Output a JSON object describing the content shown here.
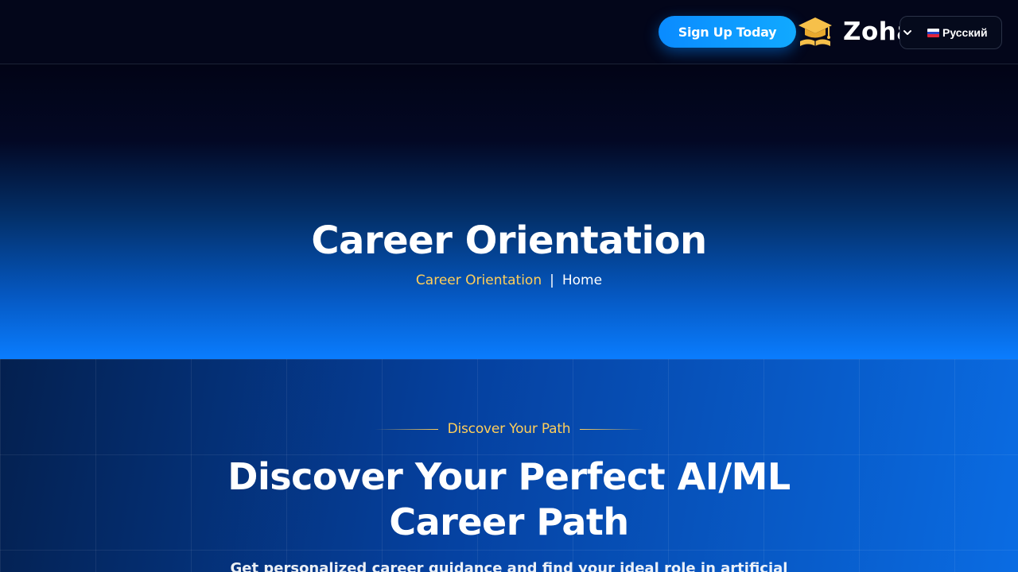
{
  "header": {
    "signup_label": "Sign Up Today",
    "logo_text": "Zoha",
    "language": {
      "selected": "Русский",
      "flag_icon": "russia-flag-icon",
      "chevron_icon": "chevron-down-icon"
    }
  },
  "hero": {
    "title": "Career Orientation",
    "breadcrumb": {
      "current": "Career Orientation",
      "separator": "|",
      "home": "Home"
    }
  },
  "section": {
    "eyebrow": "Discover Your Path",
    "title_line1": "Discover Your Perfect AI/ML",
    "title_line2": "Career Path",
    "subtitle": "Get personalized career guidance and find your ideal role in artificial"
  },
  "colors": {
    "accent_blue": "#0a8bff",
    "accent_gold": "#ffcf5a",
    "header_bg": "#03061a"
  }
}
